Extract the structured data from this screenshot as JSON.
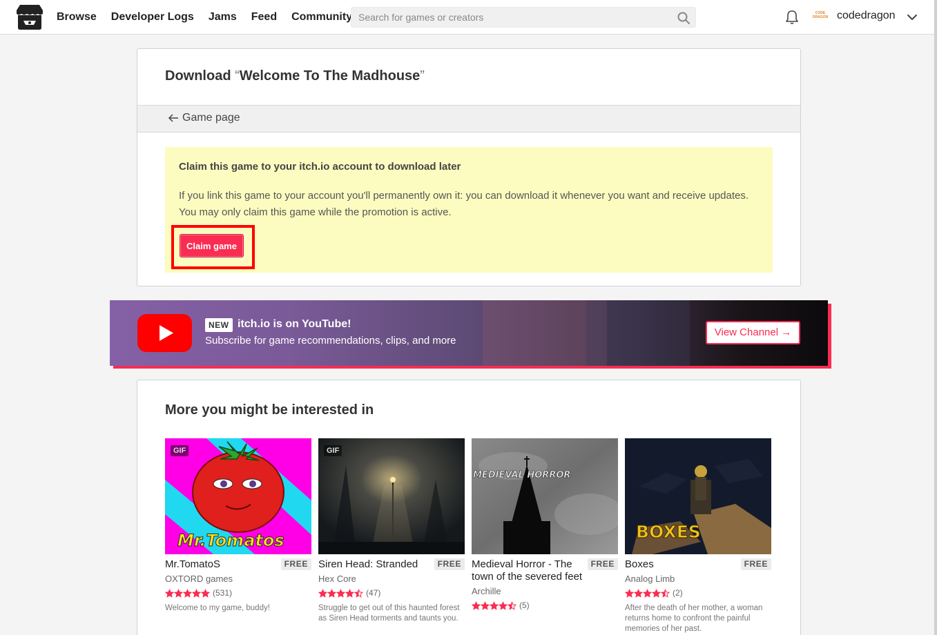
{
  "header": {
    "nav": [
      "Browse",
      "Developer Logs",
      "Jams",
      "Feed",
      "Community"
    ],
    "search_placeholder": "Search for games or creators",
    "avatar_text": "CODE DRAGON",
    "username": "codedragon"
  },
  "download": {
    "title_prefix": "Download",
    "open_quote": "“",
    "game_title": "Welcome To The Madhouse",
    "close_quote": "”",
    "back_link": "Game page",
    "claim_title": "Claim this game to your itch.io account to download later",
    "claim_desc": "If you link this game to your account you'll permanently own it: you can download it whenever you want and receive updates. You may only claim this game while the promotion is active.",
    "claim_button": "Claim game"
  },
  "banner": {
    "badge": "NEW",
    "title": "itch.io is on YouTube!",
    "subtitle": "Subscribe for game recommendations, clips, and more",
    "button": "View Channel →"
  },
  "recommendations": {
    "title": "More you might be interested in",
    "games": [
      {
        "title": "Mr.TomatoS",
        "price": "FREE",
        "author": "OXTORD games",
        "rating": 5,
        "rating_count": "(531)",
        "description": "Welcome to my game, buddy!",
        "gif": "GIF",
        "thumb_text": "Mr.Tomatos"
      },
      {
        "title": "Siren Head: Stranded",
        "price": "FREE",
        "author": "Hex Core",
        "rating": 4.5,
        "rating_count": "(47)",
        "description": "Struggle to get out of this haunted forest as Siren Head torments and taunts you.",
        "gif": "GIF"
      },
      {
        "title": "Medieval Horror - The town of the severed feet",
        "price": "FREE",
        "author": "Archille",
        "rating": 4.5,
        "rating_count": "(5)",
        "description": "",
        "thumb_text": "MEDIEVAL HORROR"
      },
      {
        "title": "Boxes",
        "price": "FREE",
        "author": "Analog Limb",
        "rating": 4.5,
        "rating_count": "(2)",
        "description": "After the death of her mother, a woman returns home to confront the painful memories of her past.",
        "thumb_text": "BOXES"
      }
    ]
  },
  "colors": {
    "accent": "#fa2c52",
    "claim_bg": "#fcfcc0",
    "highlight": "#ff0000"
  }
}
